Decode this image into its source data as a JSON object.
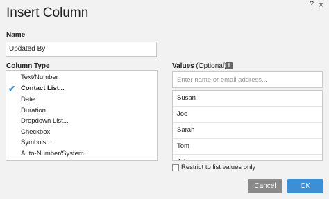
{
  "dialog": {
    "title": "Insert Column",
    "help_label": "?",
    "close_label": "×"
  },
  "name": {
    "label": "Name",
    "value": "Updated By"
  },
  "column_type": {
    "label": "Column Type",
    "selected": "Contact List...",
    "items": [
      "Text/Number",
      "Contact List...",
      "Date",
      "Duration",
      "Dropdown List...",
      "Checkbox",
      "Symbols...",
      "Auto-Number/System..."
    ]
  },
  "values": {
    "label": "Values",
    "optional_label": "(Optional)",
    "info_icon": "i",
    "placeholder": "Enter name or email address...",
    "items": [
      "Susan",
      "Joe",
      "Sarah",
      "Tom",
      "John"
    ]
  },
  "restrict": {
    "label": "Restrict to list values only",
    "checked": false
  },
  "buttons": {
    "cancel": "Cancel",
    "ok": "OK"
  },
  "colors": {
    "accent": "#3b8fd6",
    "cancel": "#8a8a8a",
    "check": "#3a8fd0"
  }
}
